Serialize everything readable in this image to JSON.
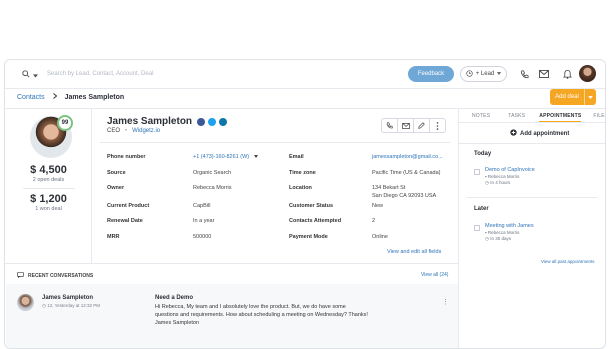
{
  "search": {
    "placeholder": "Search by Lead, Contact, Account, Deal"
  },
  "topbar": {
    "feedback": "Feedback",
    "lead": "+ Lead"
  },
  "breadcrumb": {
    "parent": "Contacts",
    "current": "James Sampleton"
  },
  "add_deal": "Add deal",
  "contact": {
    "name": "James Sampleton",
    "score": "99",
    "role": "CEO",
    "company": "Widgetz.io"
  },
  "stats": [
    {
      "amount": "$ 4,500",
      "label": "2 open deals"
    },
    {
      "amount": "$ 1,200",
      "label": "1 won deal"
    }
  ],
  "fields_left": [
    {
      "key": "Phone number",
      "value": "+1 (473)-160-8261 (W)"
    },
    {
      "key": "Source",
      "value": "Organic Search"
    },
    {
      "key": "Owner",
      "value": "Rebecca Morris"
    },
    {
      "key": "Current Product",
      "value": "CapBill"
    },
    {
      "key": "Renewal Date",
      "value": "In a year"
    },
    {
      "key": "MRR",
      "value": "500000"
    }
  ],
  "fields_right": [
    {
      "key": "Email",
      "value": "jamessampleton@gmail.co..."
    },
    {
      "key": "Time zone",
      "value": "Pacific Time (US & Canada)"
    },
    {
      "key": "Location",
      "value": "134 Bekart St"
    },
    {
      "key": "Customer Status",
      "value": "New"
    },
    {
      "key": "Contacts Attempted",
      "value": "2"
    },
    {
      "key": "Payment Mode",
      "value": "Online"
    }
  ],
  "location_line2": "San Diego CA 92093 USA",
  "view_all_fields": "View and edit all fields",
  "tabs": [
    "NOTES",
    "TASKS",
    "APPOINTMENTS",
    "FILES"
  ],
  "add_appointment": "Add appointment",
  "sections": {
    "today": "Today",
    "later": "Later"
  },
  "appointments": [
    {
      "title": "Demo of CapInvoice",
      "owner": "Rebecca Morris",
      "when": "In 4 hours"
    },
    {
      "title": "Meeting with James",
      "owner": "Rebecca Morris",
      "when": "In 30 days"
    }
  ],
  "all_past": "View all past appointments",
  "recent": {
    "title": "RECENT CONVERSATIONS",
    "view_all": "View all (24)"
  },
  "conversation": {
    "name": "James Sampleton",
    "date": "12, Yesterday at 12:32 PM",
    "subject": "Need a Demo",
    "body": "Hi Rebecca, My team and I absolutely love the product. But, we do have some questions and requirements. How about scheduling a meeting on Wednesday? Thanks! James Sampleton"
  },
  "colors": {
    "accent": "#f5a623",
    "link": "#2f74b7",
    "feedback": "#6fa7d6",
    "score": "#7bc47f"
  }
}
